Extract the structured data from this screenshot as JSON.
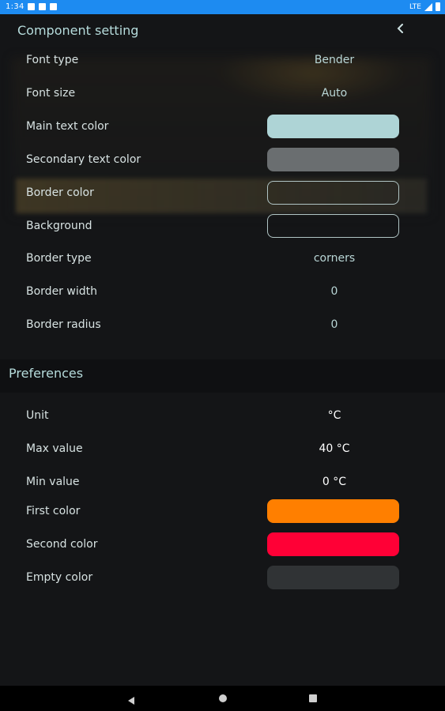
{
  "status_bar": {
    "time": "1:34",
    "network": "LTE"
  },
  "header": {
    "title": "Component setting",
    "back_icon": "chevron-left-icon"
  },
  "component_settings": {
    "font_type": {
      "label": "Font type",
      "value": "Bender"
    },
    "font_size": {
      "label": "Font size",
      "value": "Auto"
    },
    "main_text_color": {
      "label": "Main text color",
      "color": "#aed4d6"
    },
    "secondary_text_color": {
      "label": "Secondary text color",
      "color": "#6a6e70"
    },
    "border_color": {
      "label": "Border color",
      "color": "transparent"
    },
    "background": {
      "label": "Background",
      "color": "transparent"
    },
    "border_type": {
      "label": "Border type",
      "value": "corners"
    },
    "border_width": {
      "label": "Border width",
      "value": "0"
    },
    "border_radius": {
      "label": "Border radius",
      "value": "0"
    }
  },
  "preferences": {
    "title": "Preferences",
    "unit": {
      "label": "Unit",
      "value": "°C"
    },
    "max_value": {
      "label": "Max value",
      "value": "40 °C"
    },
    "min_value": {
      "label": "Min value",
      "value": "0 °C"
    },
    "first_color": {
      "label": "First color",
      "color": "#ff7f00"
    },
    "second_color": {
      "label": "Second color",
      "color": "#ff0036"
    },
    "empty_color": {
      "label": "Empty color",
      "color": "#303335"
    }
  },
  "nav_bar": {
    "back_icon": "back-triangle-icon",
    "home_icon": "home-circle-icon",
    "recents_icon": "recents-square-icon"
  }
}
